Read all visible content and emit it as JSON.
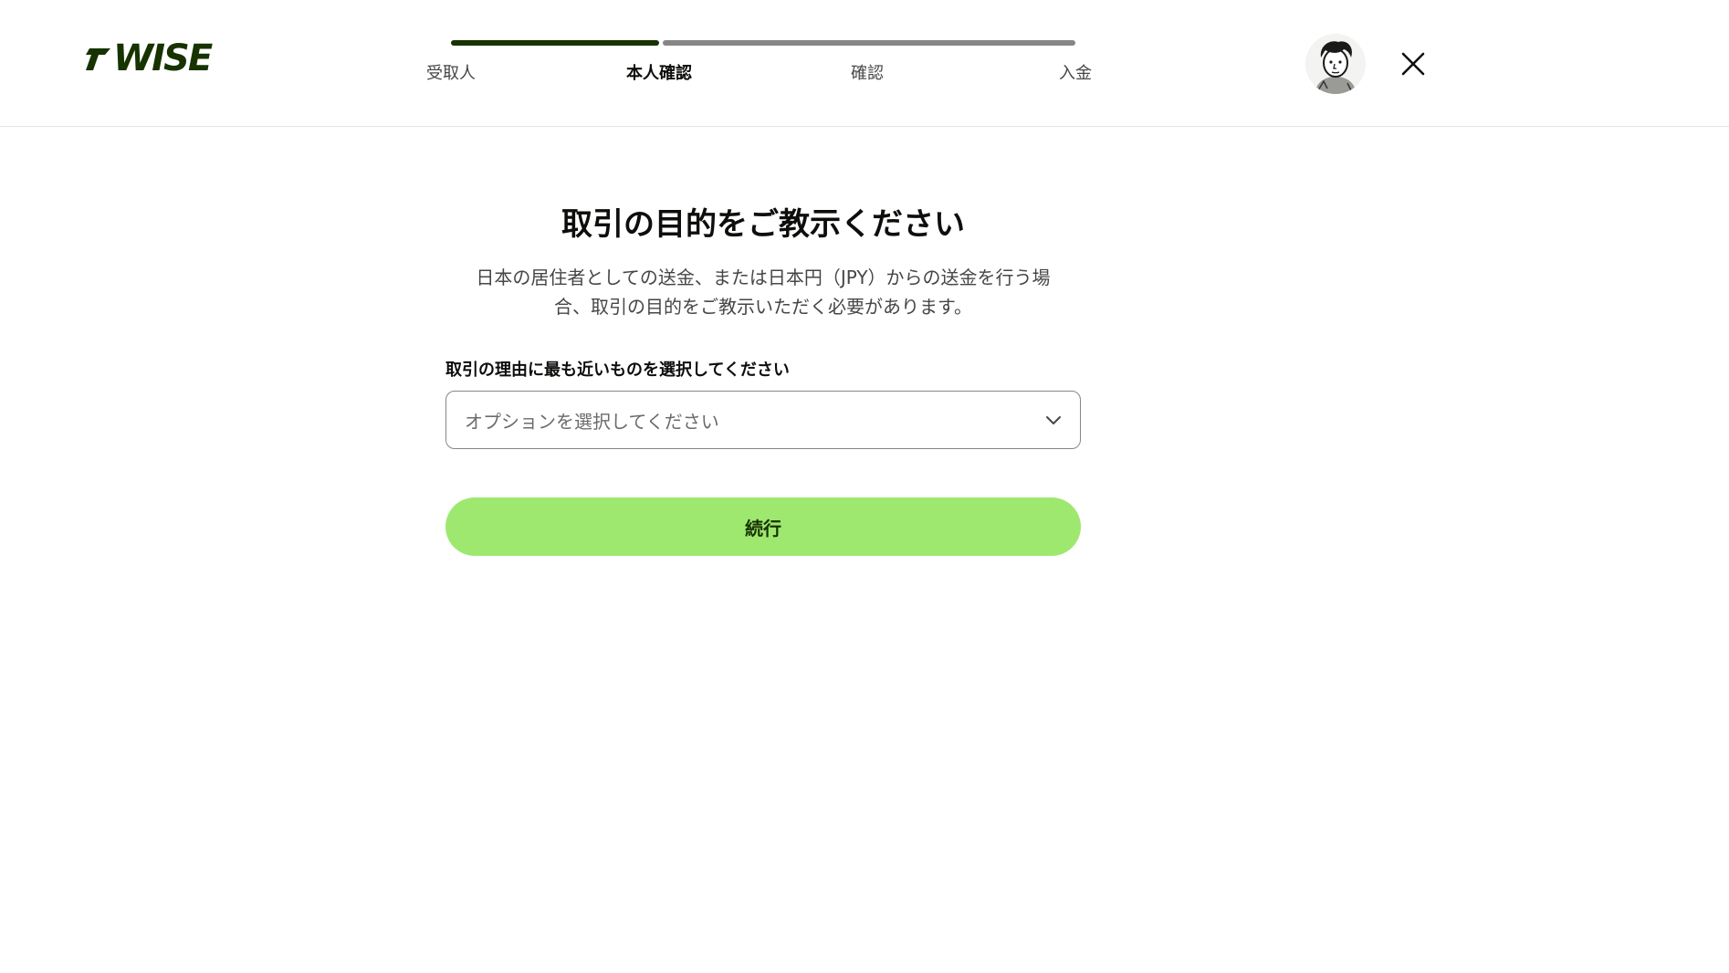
{
  "brand": {
    "name": "WISE",
    "accent": "#9fe870",
    "dark": "#163300"
  },
  "stepper": {
    "progress": 0.33,
    "steps": [
      {
        "label": "受取人",
        "state": "done"
      },
      {
        "label": "本人確認",
        "state": "current"
      },
      {
        "label": "確認",
        "state": "todo"
      },
      {
        "label": "入金",
        "state": "todo"
      }
    ]
  },
  "header": {
    "avatar_icon": "avatar-illustration",
    "close_icon": "close-icon"
  },
  "main": {
    "title": "取引の目的をご教示ください",
    "description_line1": "日本の居住者としての送金、または日本円（JPY）からの送金を行う場",
    "description_line2": "合、取引の目的をご教示いただく必要があります。",
    "field_label": "取引の理由に最も近いものを選択してください",
    "select_placeholder": "オプションを選択してください",
    "continue_label": "続行"
  }
}
